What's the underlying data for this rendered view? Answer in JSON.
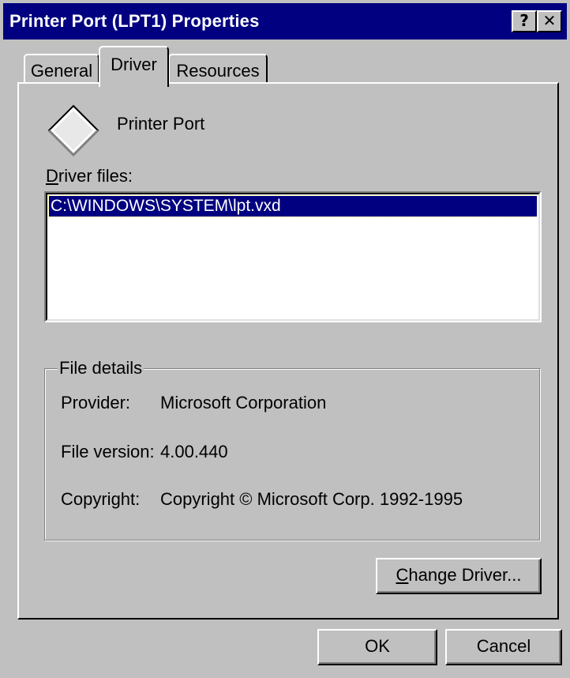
{
  "window": {
    "title": "Printer Port (LPT1) Properties",
    "help_button": "?",
    "close_button": "✕"
  },
  "tabs": [
    {
      "label": "General"
    },
    {
      "label": "Driver"
    },
    {
      "label": "Resources"
    }
  ],
  "driver_tab": {
    "device_name": "Printer Port",
    "device_icon": "diamond-device-icon",
    "driver_files_label_first": "D",
    "driver_files_label_rest": "river files:",
    "driver_files": [
      "C:\\WINDOWS\\SYSTEM\\lpt.vxd"
    ],
    "file_details": {
      "legend": "File details",
      "provider_label": "Provider:",
      "provider_value": "Microsoft Corporation",
      "version_label": "File version:",
      "version_value": "4.00.440",
      "copyright_label": "Copyright:",
      "copyright_value": "Copyright © Microsoft Corp. 1992-1995"
    },
    "change_driver_first": "C",
    "change_driver_rest": "hange Driver..."
  },
  "footer": {
    "ok_label": "OK",
    "cancel_label": "Cancel"
  },
  "colors": {
    "title_bar": "#000080",
    "face": "#c0c0c0",
    "selection": "#000080"
  }
}
